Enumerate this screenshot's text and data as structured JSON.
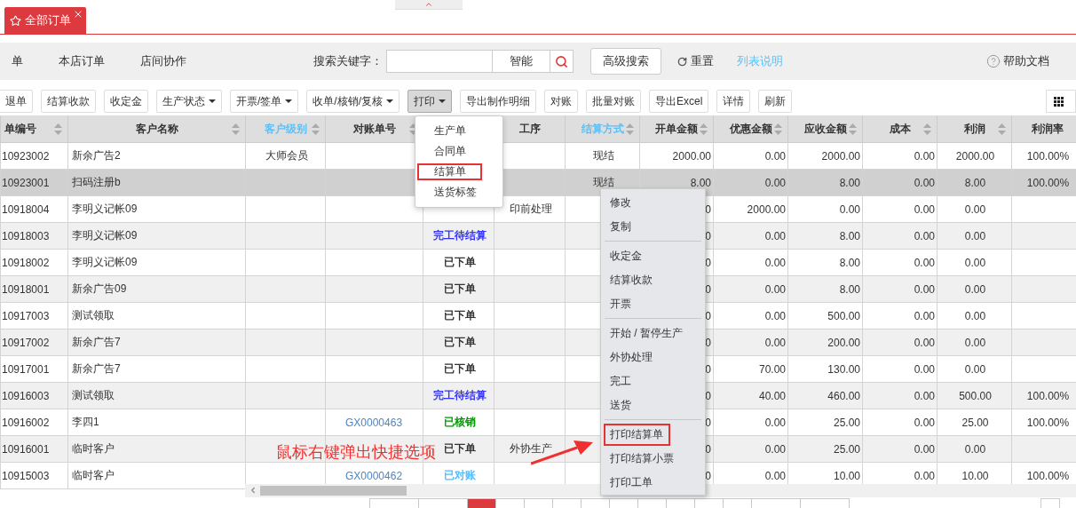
{
  "tabs": [
    {
      "label": "全部订单",
      "selected": true
    }
  ],
  "filter_bar": {
    "scopes": [
      "单",
      "本店订单",
      "店间协作"
    ],
    "search_label": "搜索关键字：",
    "search_mode": "智能",
    "advanced_button": "高级搜索",
    "reset_button": "重置",
    "list_help_link": "列表说明",
    "help_docs": "帮助文档"
  },
  "toolbar": [
    {
      "label": "退单",
      "dropdown": false,
      "pressed": false
    },
    {
      "label": "结算收款",
      "dropdown": false,
      "pressed": false
    },
    {
      "label": "收定金",
      "dropdown": false,
      "pressed": false
    },
    {
      "label": "生产状态",
      "dropdown": true,
      "pressed": false
    },
    {
      "label": "开票/签单",
      "dropdown": true,
      "pressed": false
    },
    {
      "label": "收单/核销/复核",
      "dropdown": true,
      "pressed": false
    },
    {
      "label": "打印",
      "dropdown": true,
      "pressed": true
    },
    {
      "label": "导出制作明细",
      "dropdown": false,
      "pressed": false
    },
    {
      "label": "对账",
      "dropdown": false,
      "pressed": false
    },
    {
      "label": "批量对账",
      "dropdown": false,
      "pressed": false
    },
    {
      "label": "导出Excel",
      "dropdown": false,
      "pressed": false
    },
    {
      "label": "详情",
      "dropdown": false,
      "pressed": false
    },
    {
      "label": "刷新",
      "dropdown": false,
      "pressed": false
    }
  ],
  "table": {
    "columns": [
      {
        "label": "单编号",
        "sortable": true,
        "linked": false
      },
      {
        "label": "客户名称",
        "sortable": true,
        "linked": false
      },
      {
        "label": "客户级别",
        "sortable": true,
        "linked": true
      },
      {
        "label": "对账单号",
        "sortable": true,
        "linked": false
      },
      {},
      {
        "label": "工序",
        "sortable": false,
        "linked": false
      },
      {
        "label": "结算方式",
        "sortable": true,
        "linked": true
      },
      {
        "label": "开单金额",
        "sortable": true,
        "linked": false
      },
      {
        "label": "优惠金额",
        "sortable": true,
        "linked": false
      },
      {
        "label": "应收金额",
        "sortable": true,
        "linked": false
      },
      {
        "label": "成本",
        "sortable": true,
        "linked": false
      },
      {
        "label": "利润",
        "sortable": true,
        "linked": false
      },
      {
        "label": "利润率",
        "sortable": false,
        "linked": false
      }
    ],
    "rows": [
      {
        "selected": false,
        "cells": [
          "10923002",
          "新余广告2",
          "大师会员",
          "",
          null,
          "",
          "现结",
          "2000.00",
          "0.00",
          "2000.00",
          "0.00",
          "2000.00",
          "100.00%"
        ]
      },
      {
        "selected": true,
        "cells": [
          "10923001",
          "扫码注册b",
          "",
          "",
          null,
          "",
          "现结",
          "8.00",
          "0.00",
          "8.00",
          "0.00",
          "8.00",
          "100.00%"
        ]
      },
      {
        "selected": false,
        "cells": [
          "10918004",
          "李明义记帐09",
          "",
          "",
          null,
          "印前处理",
          "",
          "0",
          "2000.00",
          "0.00",
          "0.00",
          "0.00",
          ""
        ]
      },
      {
        "selected": false,
        "cells": [
          "10918003",
          "李明义记帐09",
          "",
          "",
          {
            "text": "完工待结算",
            "color": "#3333ff"
          },
          "",
          "",
          "0",
          "0.00",
          "8.00",
          "0.00",
          "0.00",
          ""
        ]
      },
      {
        "selected": false,
        "cells": [
          "10918002",
          "李明义记帐09",
          "",
          "",
          {
            "text": "已下单",
            "color": "#333333"
          },
          "",
          "",
          "0",
          "0.00",
          "8.00",
          "0.00",
          "0.00",
          ""
        ]
      },
      {
        "selected": false,
        "cells": [
          "10918001",
          "新余广告09",
          "",
          "",
          {
            "text": "已下单",
            "color": "#333333"
          },
          "",
          "",
          "0",
          "0.00",
          "8.00",
          "0.00",
          "0.00",
          ""
        ]
      },
      {
        "selected": false,
        "cells": [
          "10917003",
          "测试领取",
          "",
          "",
          {
            "text": "已下单",
            "color": "#333333"
          },
          "",
          "",
          "0",
          "0.00",
          "500.00",
          "0.00",
          "0.00",
          ""
        ]
      },
      {
        "selected": false,
        "cells": [
          "10917002",
          "新余广告7",
          "",
          "",
          {
            "text": "已下单",
            "color": "#333333"
          },
          "",
          "",
          "0",
          "0.00",
          "200.00",
          "0.00",
          "0.00",
          ""
        ]
      },
      {
        "selected": false,
        "cells": [
          "10917001",
          "新余广告7",
          "",
          "",
          {
            "text": "已下单",
            "color": "#333333"
          },
          "",
          "",
          "0",
          "70.00",
          "130.00",
          "0.00",
          "0.00",
          ""
        ]
      },
      {
        "selected": false,
        "cells": [
          "10916003",
          "测试领取",
          "",
          "",
          {
            "text": "完工待结算",
            "color": "#3333ff"
          },
          "",
          "",
          "0",
          "40.00",
          "460.00",
          "0.00",
          "500.00",
          "100.00%"
        ]
      },
      {
        "selected": false,
        "cells": [
          "10916002",
          "李四1",
          "",
          "GX0000463",
          {
            "text": "已核销",
            "color": "#009900"
          },
          "",
          "",
          "0",
          "0.00",
          "25.00",
          "0.00",
          "25.00",
          "100.00%"
        ]
      },
      {
        "selected": false,
        "cells": [
          "10916001",
          "临时客户",
          "",
          "",
          {
            "text": "已下单",
            "color": "#333333"
          },
          "外协生产",
          "",
          "0",
          "0.00",
          "25.00",
          "0.00",
          "0.00",
          ""
        ]
      },
      {
        "selected": false,
        "cells": [
          "10915003",
          "临时客户",
          "",
          "GX0000462",
          {
            "text": "已对账",
            "color": "#55bbff"
          },
          "",
          "",
          "0",
          "0.00",
          "10.00",
          "0.00",
          "10.00",
          "100.00%"
        ]
      }
    ]
  },
  "print_menu": [
    {
      "label": "生产单",
      "highlighted": false
    },
    {
      "label": "合同单",
      "highlighted": false
    },
    {
      "label": "结算单",
      "highlighted": true
    },
    {
      "label": "送货标签",
      "highlighted": false
    }
  ],
  "context_menu": [
    [
      {
        "label": "修改",
        "highlighted": false
      },
      {
        "label": "复制",
        "highlighted": false
      }
    ],
    [
      {
        "label": "收定金",
        "highlighted": false
      },
      {
        "label": "结算收款",
        "highlighted": false
      },
      {
        "label": "开票",
        "highlighted": false
      }
    ],
    [
      {
        "label": "开始 / 暂停生产",
        "highlighted": false
      },
      {
        "label": "外协处理",
        "highlighted": false
      },
      {
        "label": "完工",
        "highlighted": false
      },
      {
        "label": "送货",
        "highlighted": false
      }
    ],
    [
      {
        "label": "打印结算单",
        "highlighted": true
      },
      {
        "label": "打印结算小票",
        "highlighted": false
      },
      {
        "label": "打印工单",
        "highlighted": false
      }
    ]
  ],
  "annotation": {
    "text": "鼠标右键弹出快捷选项"
  },
  "pagination": {
    "buttons": [
      {
        "kind": "wide",
        "selected": false
      },
      {
        "kind": "wide",
        "selected": false
      },
      {
        "kind": "page",
        "selected": true
      },
      {
        "kind": "page",
        "selected": false
      },
      {
        "kind": "page",
        "selected": false
      },
      {
        "kind": "page",
        "selected": false
      },
      {
        "kind": "page",
        "selected": false
      },
      {
        "kind": "page",
        "selected": false
      },
      {
        "kind": "page",
        "selected": false
      },
      {
        "kind": "page",
        "selected": false
      },
      {
        "kind": "page",
        "selected": false
      },
      {
        "kind": "page",
        "selected": false
      },
      {
        "kind": "wide",
        "selected": false
      },
      {
        "kind": "wide",
        "selected": false
      }
    ]
  }
}
